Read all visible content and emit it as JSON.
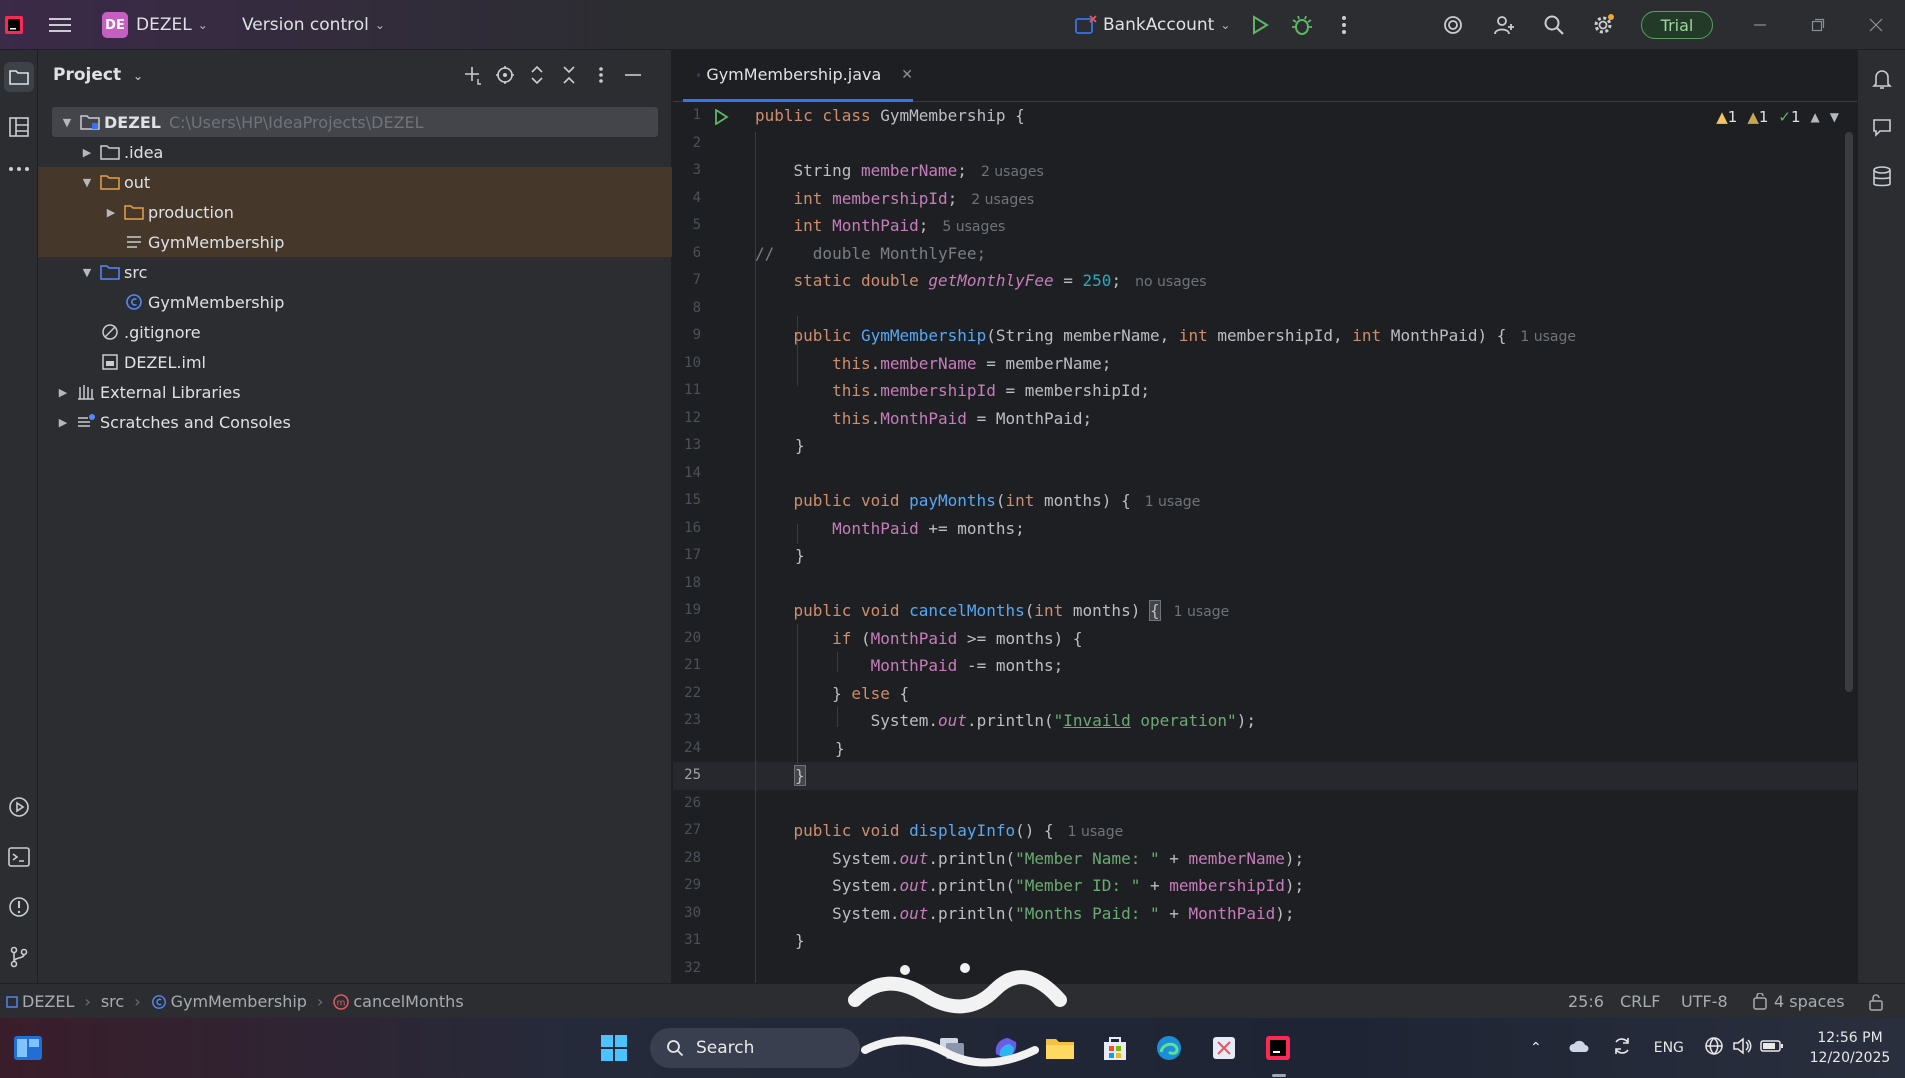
{
  "titlebar": {
    "project_badge": "DE",
    "project_name": "DEZEL",
    "version_control": "Version control",
    "run_config": "BankAccount",
    "trial_label": "Trial"
  },
  "project_panel": {
    "title": "Project",
    "tree": [
      {
        "label": "DEZEL",
        "path": "C:\\Users\\HP\\IdeaProjects\\DEZEL"
      },
      {
        "label": ".idea"
      },
      {
        "label": "out"
      },
      {
        "label": "production"
      },
      {
        "label": "GymMembership"
      },
      {
        "label": "src"
      },
      {
        "label": "GymMembership"
      },
      {
        "label": ".gitignore"
      },
      {
        "label": "DEZEL.iml"
      },
      {
        "label": "External Libraries"
      },
      {
        "label": "Scratches and Consoles"
      }
    ]
  },
  "editor": {
    "tab_label": "GymMembership.java",
    "inspections": {
      "warnings": "1",
      "weak_warnings": "1",
      "ok": "1"
    },
    "current_line": "25",
    "hints": {
      "two_usages": "2 usages",
      "five_usages": "5 usages",
      "no_usages": "no usages",
      "one_usage": "1 usage"
    },
    "code": {
      "l1_kw": "public class ",
      "l1_name": "GymMembership",
      "l1_end": " {",
      "l3_type": "String ",
      "l3_fld": "memberName",
      "l3_end": ";",
      "l4_type": "int ",
      "l4_fld": "membershipId",
      "l4_end": ";",
      "l5_type": "int ",
      "l5_fld": "MonthPaid",
      "l5_end": ";",
      "l6_cmt": "//    double MonthlyFee;",
      "l7_kw": "static double ",
      "l7_fld": "getMonthlyFee",
      "l7_op": " = ",
      "l7_num": "250",
      "l7_end": ";",
      "l9_kw": "public ",
      "l9_fn": "GymMembership",
      "l9_p1": "(String memberName, ",
      "l9_int1": "int",
      "l9_p2": " membershipId, ",
      "l9_int2": "int",
      "l9_p3": " MonthPaid) {",
      "l10_this": "this",
      "l10_dot": ".",
      "l10_fld": "memberName",
      "l10_rest": " = memberName;",
      "l11_this": "this",
      "l11_dot": ".",
      "l11_fld": "membershipId",
      "l11_rest": " = membershipId;",
      "l12_this": "this",
      "l12_dot": ".",
      "l12_fld": "MonthPaid",
      "l12_rest": " = MonthPaid;",
      "close": "}",
      "l15_kw": "public void ",
      "l15_fn": "payMonths",
      "l15_p1": "(",
      "l15_int": "int",
      "l15_p2": " months) {",
      "l16_fld": "MonthPaid",
      "l16_rest": " += months;",
      "l19_kw": "public void ",
      "l19_fn": "cancelMonths",
      "l19_p1": "(",
      "l19_int": "int",
      "l19_p2": " months) ",
      "l19_brace": "{",
      "l20_kw": "if",
      "l20_p1": " (",
      "l20_fld": "MonthPaid",
      "l20_rest": " >= months) {",
      "l21_fld": "MonthPaid",
      "l21_rest": " -= months;",
      "l22_a": "} ",
      "l22_kw": "else",
      "l22_b": " {",
      "l23_a": "System.",
      "l23_out": "out",
      "l23_b": ".println(",
      "l23_q": "\"",
      "l23_typo": "Invaild",
      "l23_str": " operation\"",
      "l23_end": ");",
      "l27_kw": "public void ",
      "l27_fn": "displayInfo",
      "l27_rest": "() {",
      "l28_a": "System.",
      "l28_out": "out",
      "l28_b": ".println(",
      "l28_str": "\"Member Name: \"",
      "l28_op": " + ",
      "l28_fld": "memberName",
      "l28_end": ");",
      "l29_a": "System.",
      "l29_out": "out",
      "l29_b": ".println(",
      "l29_str": "\"Member ID: \"",
      "l29_op": " + ",
      "l29_fld": "membershipId",
      "l29_end": ");",
      "l30_a": "System.",
      "l30_out": "out",
      "l30_b": ".println(",
      "l30_str": "\"Months Paid: \"",
      "l30_op": " + ",
      "l30_fld": "MonthPaid",
      "l30_end": ");"
    },
    "line_numbers": [
      "1",
      "2",
      "3",
      "4",
      "5",
      "6",
      "7",
      "8",
      "9",
      "10",
      "11",
      "12",
      "13",
      "14",
      "15",
      "16",
      "17",
      "18",
      "19",
      "20",
      "21",
      "22",
      "23",
      "24",
      "25",
      "26",
      "27",
      "28",
      "29",
      "30",
      "31",
      "32"
    ]
  },
  "statusbar": {
    "breadcrumb": [
      "DEZEL",
      "src",
      "GymMembership",
      "cancelMonths"
    ],
    "position": "25:6",
    "line_sep": "CRLF",
    "encoding": "UTF-8",
    "indent": "4 spaces"
  },
  "taskbar": {
    "search_label": "Search",
    "lang": "ENG",
    "time": "12:56 PM",
    "date": "12/20/2025"
  },
  "colors": {
    "accent": "#3574f0",
    "keyword": "#cf8e6d",
    "field": "#c77dbb",
    "function": "#56a8f5",
    "string": "#6aab73",
    "number": "#2aacb8"
  }
}
